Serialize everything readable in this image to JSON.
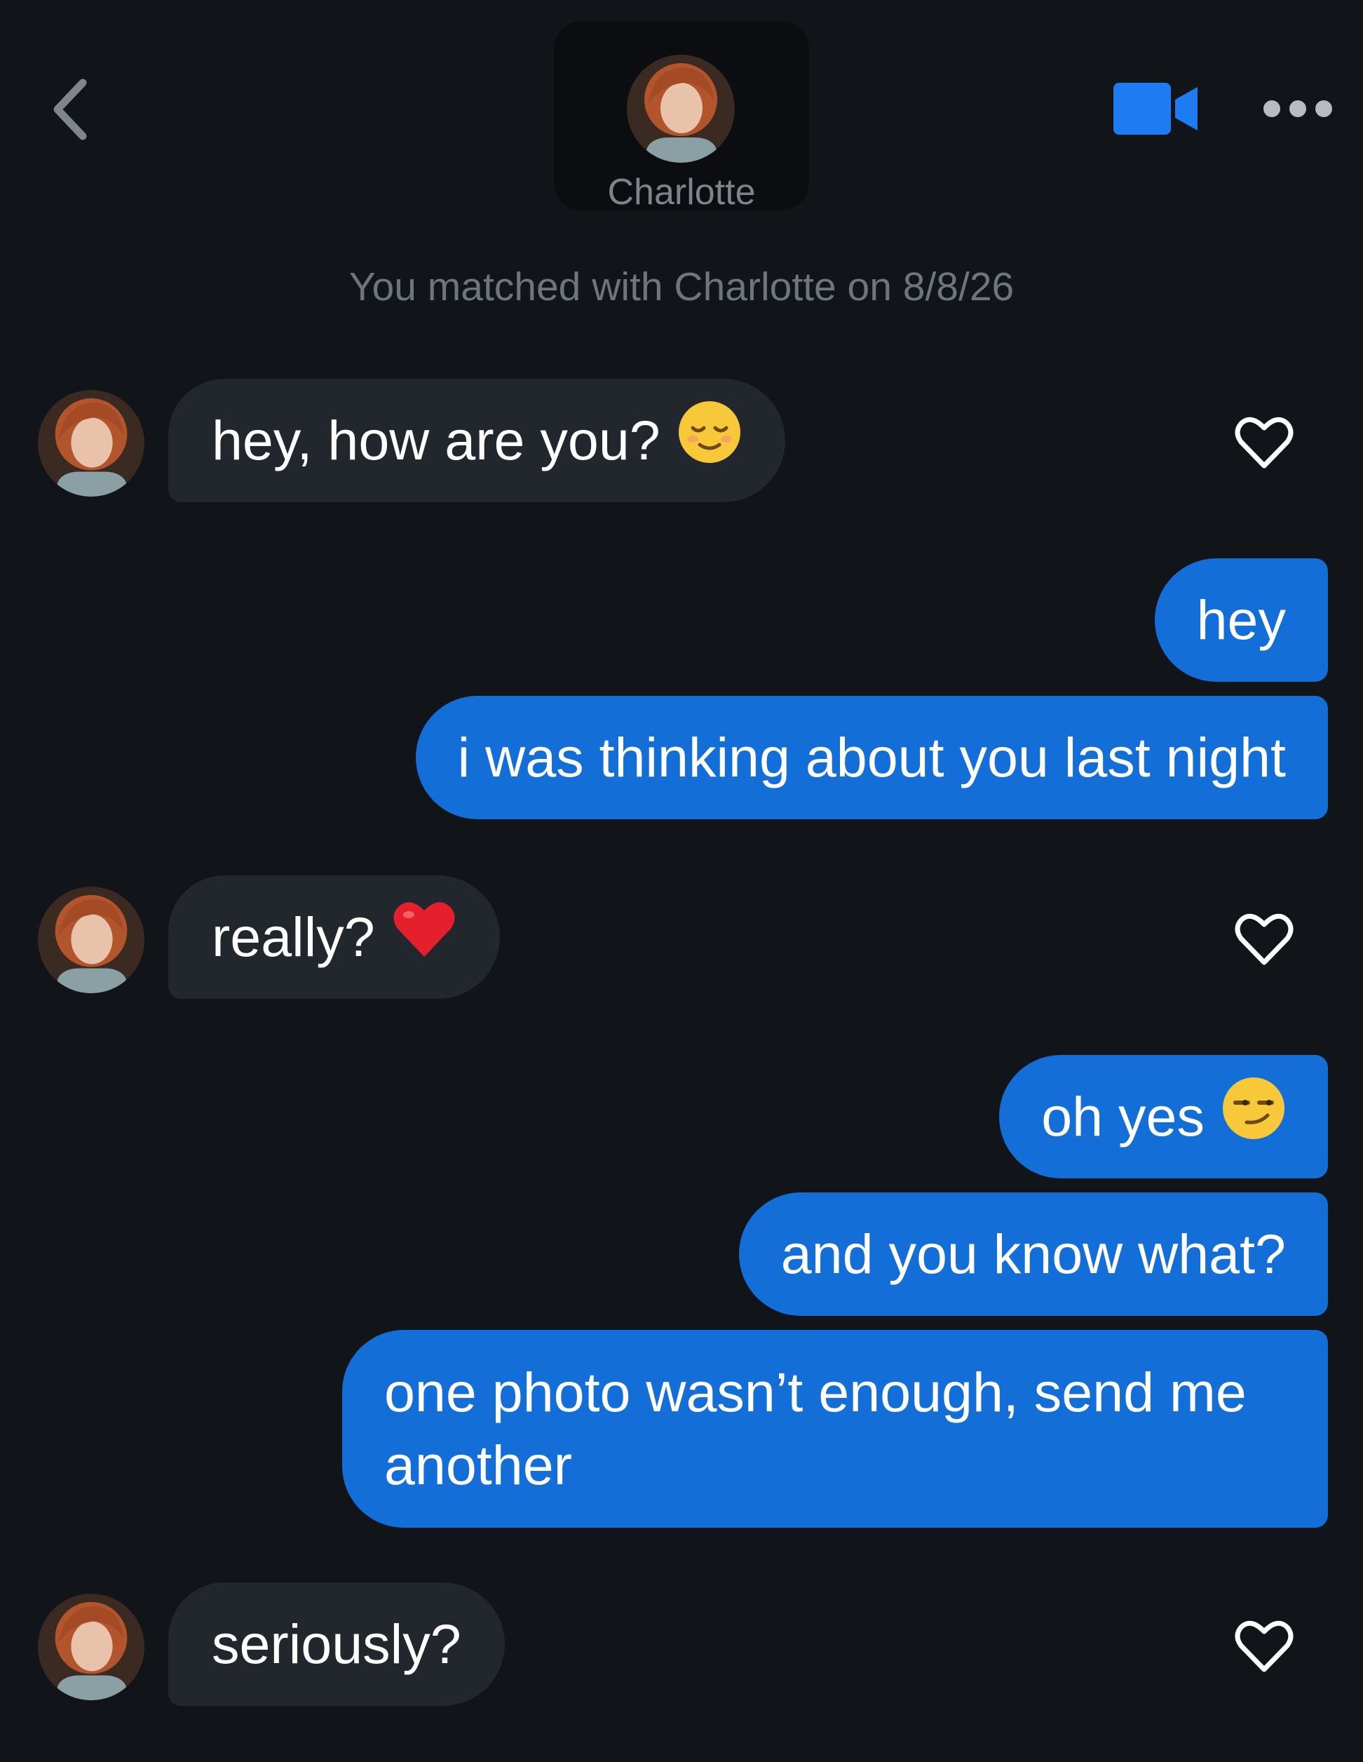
{
  "header": {
    "name": "Charlotte",
    "back_icon": "chevron-left-icon",
    "video_icon": "video-camera-icon",
    "more_icon": "more-horizontal-icon",
    "accent_color": "#1d7cf2"
  },
  "match_notice": "You matched with Charlotte on 8/8/26",
  "messages": [
    {
      "from": "them",
      "text": "hey, how are you?",
      "emoji": "relieved-face-emoji"
    },
    {
      "from": "me",
      "text": "hey"
    },
    {
      "from": "me",
      "text": "i was thinking about you last night"
    },
    {
      "from": "them",
      "text": "really?",
      "emoji": "red-heart-emoji"
    },
    {
      "from": "me",
      "text": "oh yes",
      "emoji": "smirking-face-emoji"
    },
    {
      "from": "me",
      "text": "and you know what?"
    },
    {
      "from": "me",
      "text": "one photo wasn’t enough, send me another"
    },
    {
      "from": "them",
      "text": "seriously?"
    }
  ],
  "colors": {
    "background": "#11151a",
    "incoming_bubble": "#22262d",
    "outgoing_bubble": "#146ed8"
  }
}
